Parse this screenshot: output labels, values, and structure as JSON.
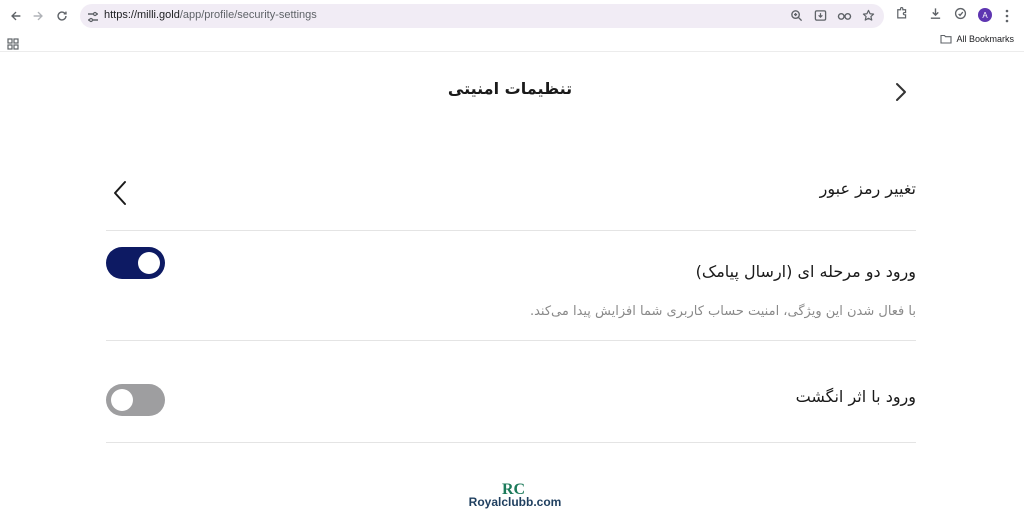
{
  "browser": {
    "url_host": "https://milli.gold",
    "url_path": "/app/profile/security-settings",
    "avatar_letter": "A",
    "bookmarks_label": "All Bookmarks",
    "icons": [
      "back-arrow-icon",
      "forward-arrow-icon",
      "reload-icon",
      "site-info-icon",
      "zoom-icon",
      "install-app-icon",
      "password-key-icon",
      "star-icon",
      "extensions-icon",
      "download-icon",
      "profile-sync-icon",
      "menu-dots-icon",
      "apps-grid-icon",
      "folder-icon"
    ]
  },
  "header": {
    "title": "تنظیمات امنیتی"
  },
  "settings": {
    "items": [
      {
        "label": "تغییر رمز عبور",
        "type": "link"
      },
      {
        "label": "ورود دو مرحله ای (ارسال پیامک)",
        "description": "با فعال شدن این ویژگی، امنیت حساب کاربری شما افزایش پیدا می‌کند.",
        "type": "toggle",
        "enabled": true
      },
      {
        "label": "ورود با اثر انگشت",
        "type": "toggle",
        "enabled": false
      }
    ]
  },
  "colors": {
    "toggle_on": "#0d1a63",
    "toggle_off": "#9e9ea0",
    "omnibox_bg": "#f1ecf5"
  },
  "watermark": {
    "logo_text": "RC",
    "text": "Royalclubb.com"
  }
}
